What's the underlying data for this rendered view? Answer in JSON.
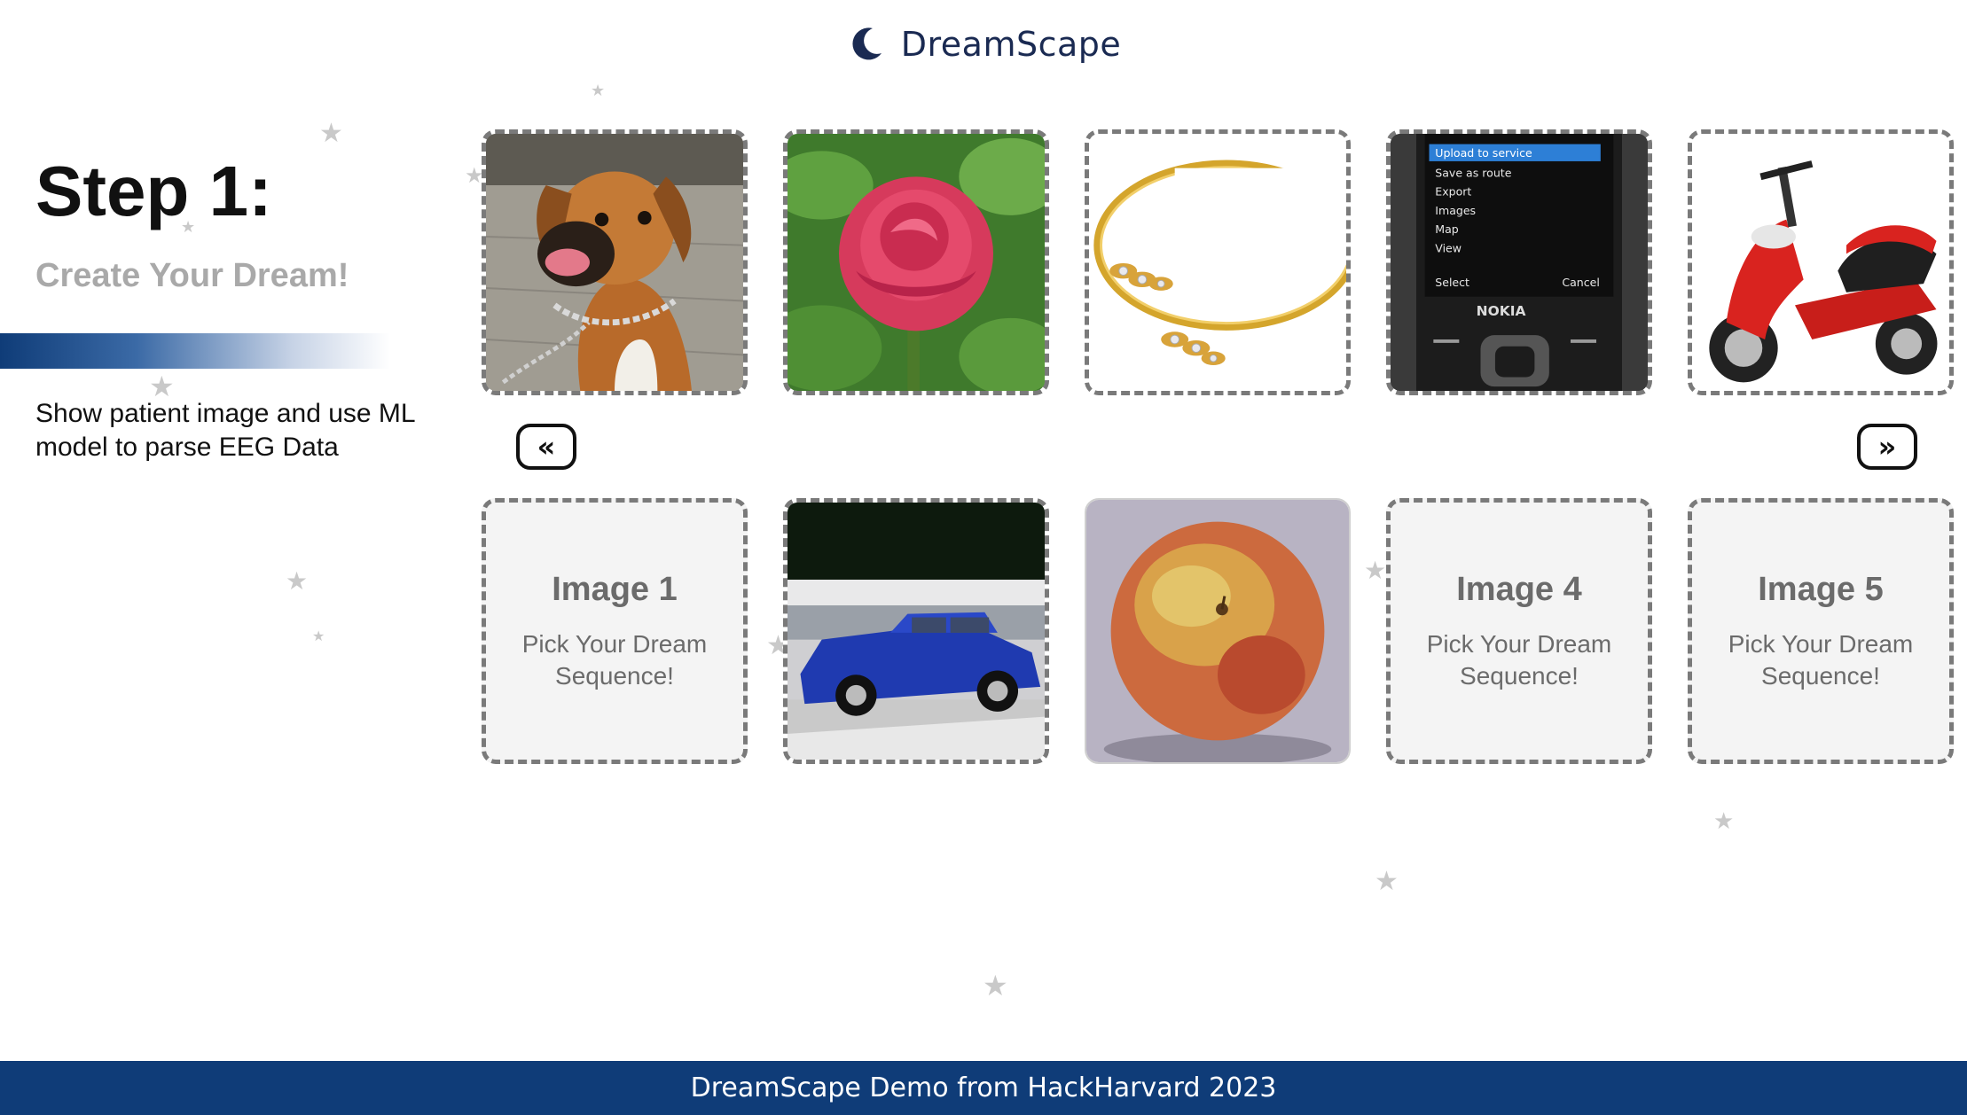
{
  "header": {
    "brand_name": "DreamScape",
    "brand_icon": "moon-icon",
    "brand_color": "#1a2a52"
  },
  "intro": {
    "step_label": "Step 1:",
    "subtitle": "Create Your Dream!",
    "description": "Show patient image and use ML model to parse EEG Data"
  },
  "gallery": {
    "items": [
      {
        "name": "dog"
      },
      {
        "name": "rose"
      },
      {
        "name": "bracelet"
      },
      {
        "name": "nokia-phone"
      },
      {
        "name": "scooter"
      }
    ],
    "prev_label": "«",
    "next_label": "»"
  },
  "sequence": {
    "slots": [
      {
        "title": "Image 1",
        "hint": "Pick Your Dream Sequence!"
      },
      {
        "image": "blue-car"
      },
      {
        "image": "apple"
      },
      {
        "title": "Image 4",
        "hint": "Pick Your Dream Sequence!"
      },
      {
        "title": "Image 5",
        "hint": "Pick Your Dream Sequence!"
      }
    ]
  },
  "footer": {
    "text": "DreamScape Demo from HackHarvard 2023",
    "color": "#0f3c78"
  },
  "colors": {
    "accent": "#0f3c78",
    "muted_text": "#a9a9a9",
    "tile_border": "#7a7a7a"
  }
}
